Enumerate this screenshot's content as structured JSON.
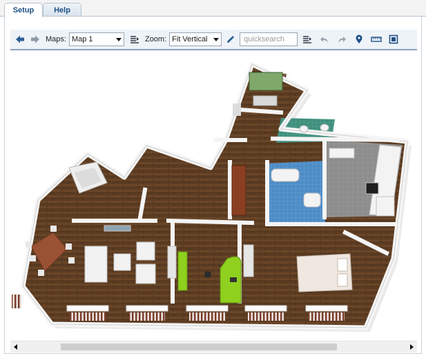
{
  "tabs": [
    {
      "label": "Setup",
      "active": true
    },
    {
      "label": "Help",
      "active": false
    }
  ],
  "toolbar": {
    "maps_label": "Maps:",
    "maps_value": "Map 1",
    "zoom_label": "Zoom:",
    "zoom_value": "Fit Vertical",
    "search_placeholder": "quicksearch",
    "icons": [
      "arrow-left-icon",
      "arrow-right-icon",
      "list-icon",
      "pencil-icon",
      "list-icon",
      "undo-icon",
      "redo-icon",
      "map-pin-icon",
      "ruler-icon",
      "frame-icon"
    ]
  },
  "colors": {
    "accent": "#1e4f86",
    "toolbar_bg": "#eef3f8",
    "floor_wood": "#5c3d22",
    "wall": "#f4f4f4",
    "tile_blue": "#4f8fc8",
    "accent_green": "#8fd11e"
  },
  "map": {
    "content": "3D floor plan of an apartment"
  }
}
